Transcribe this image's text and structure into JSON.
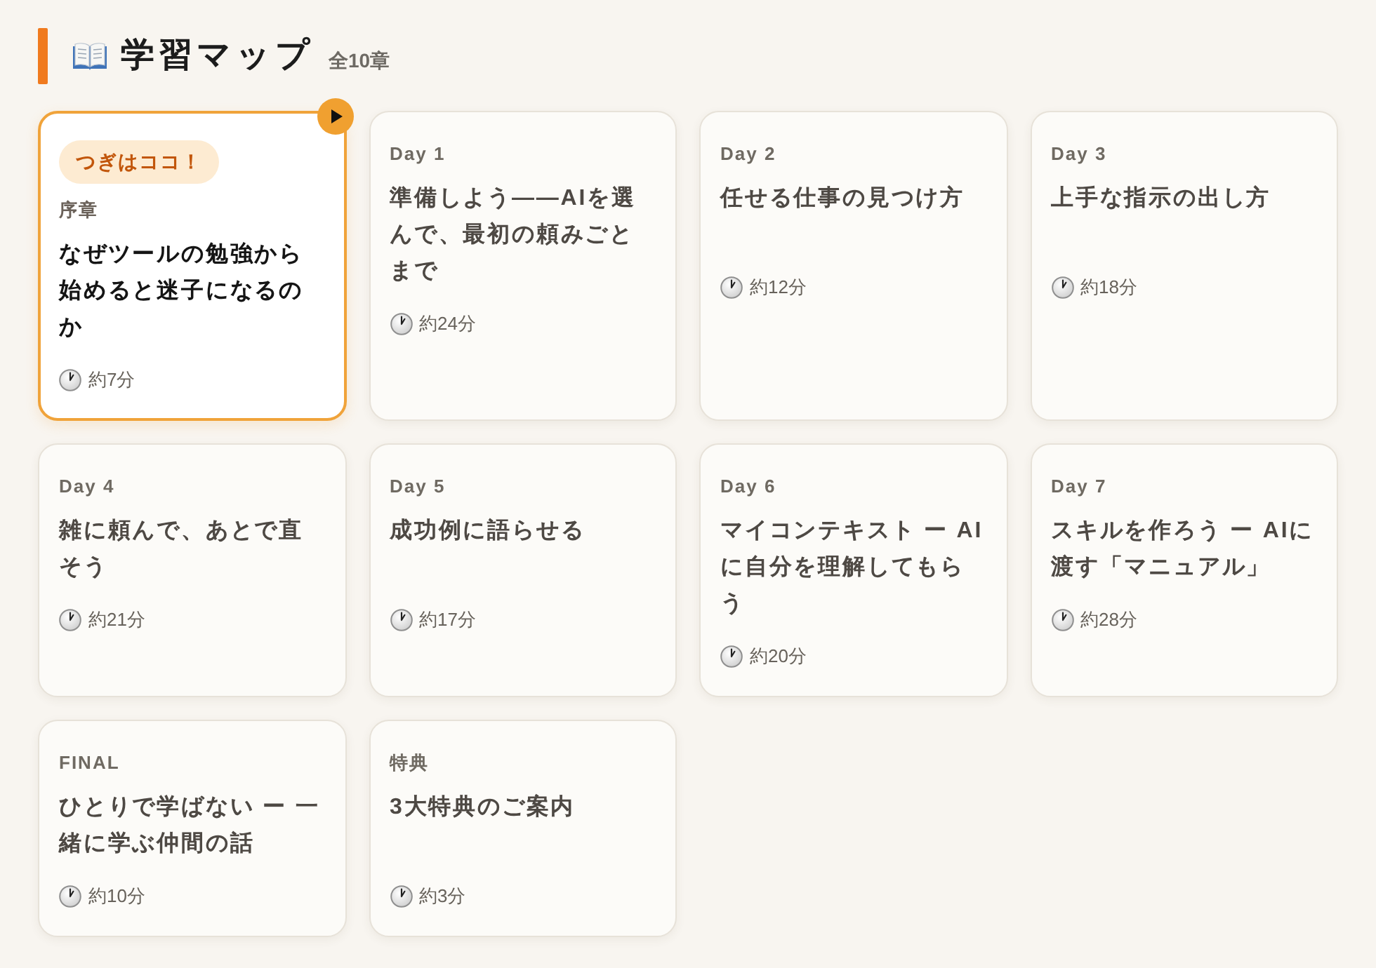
{
  "header": {
    "title": "学習マップ",
    "count": "全10章"
  },
  "chapters": [
    {
      "label": "序章",
      "title": "なぜツールの勉強から始めると迷子になるのか",
      "duration": "約7分",
      "current": true,
      "badge": "つぎはココ！"
    },
    {
      "label": "Day 1",
      "title": "準備しよう——AIを選んで、最初の頼みごとまで",
      "duration": "約24分",
      "current": false
    },
    {
      "label": "Day 2",
      "title": "任せる仕事の見つけ方",
      "duration": "約12分",
      "current": false
    },
    {
      "label": "Day 3",
      "title": "上手な指示の出し方",
      "duration": "約18分",
      "current": false
    },
    {
      "label": "Day 4",
      "title": "雑に頼んで、あとで直そう",
      "duration": "約21分",
      "current": false
    },
    {
      "label": "Day 5",
      "title": "成功例に語らせる",
      "duration": "約17分",
      "current": false
    },
    {
      "label": "Day 6",
      "title": "マイコンテキスト ー AIに自分を理解してもらう",
      "duration": "約20分",
      "current": false
    },
    {
      "label": "Day 7",
      "title": "スキルを作ろう ー AIに渡す「マニュアル」",
      "duration": "約28分",
      "current": false
    },
    {
      "label": "FINAL",
      "title": "ひとりで学ばない ー 一緒に学ぶ仲間の話",
      "duration": "約10分",
      "current": false
    },
    {
      "label": "特典",
      "title": "3大特典のご案内",
      "duration": "約3分",
      "current": false
    }
  ]
}
